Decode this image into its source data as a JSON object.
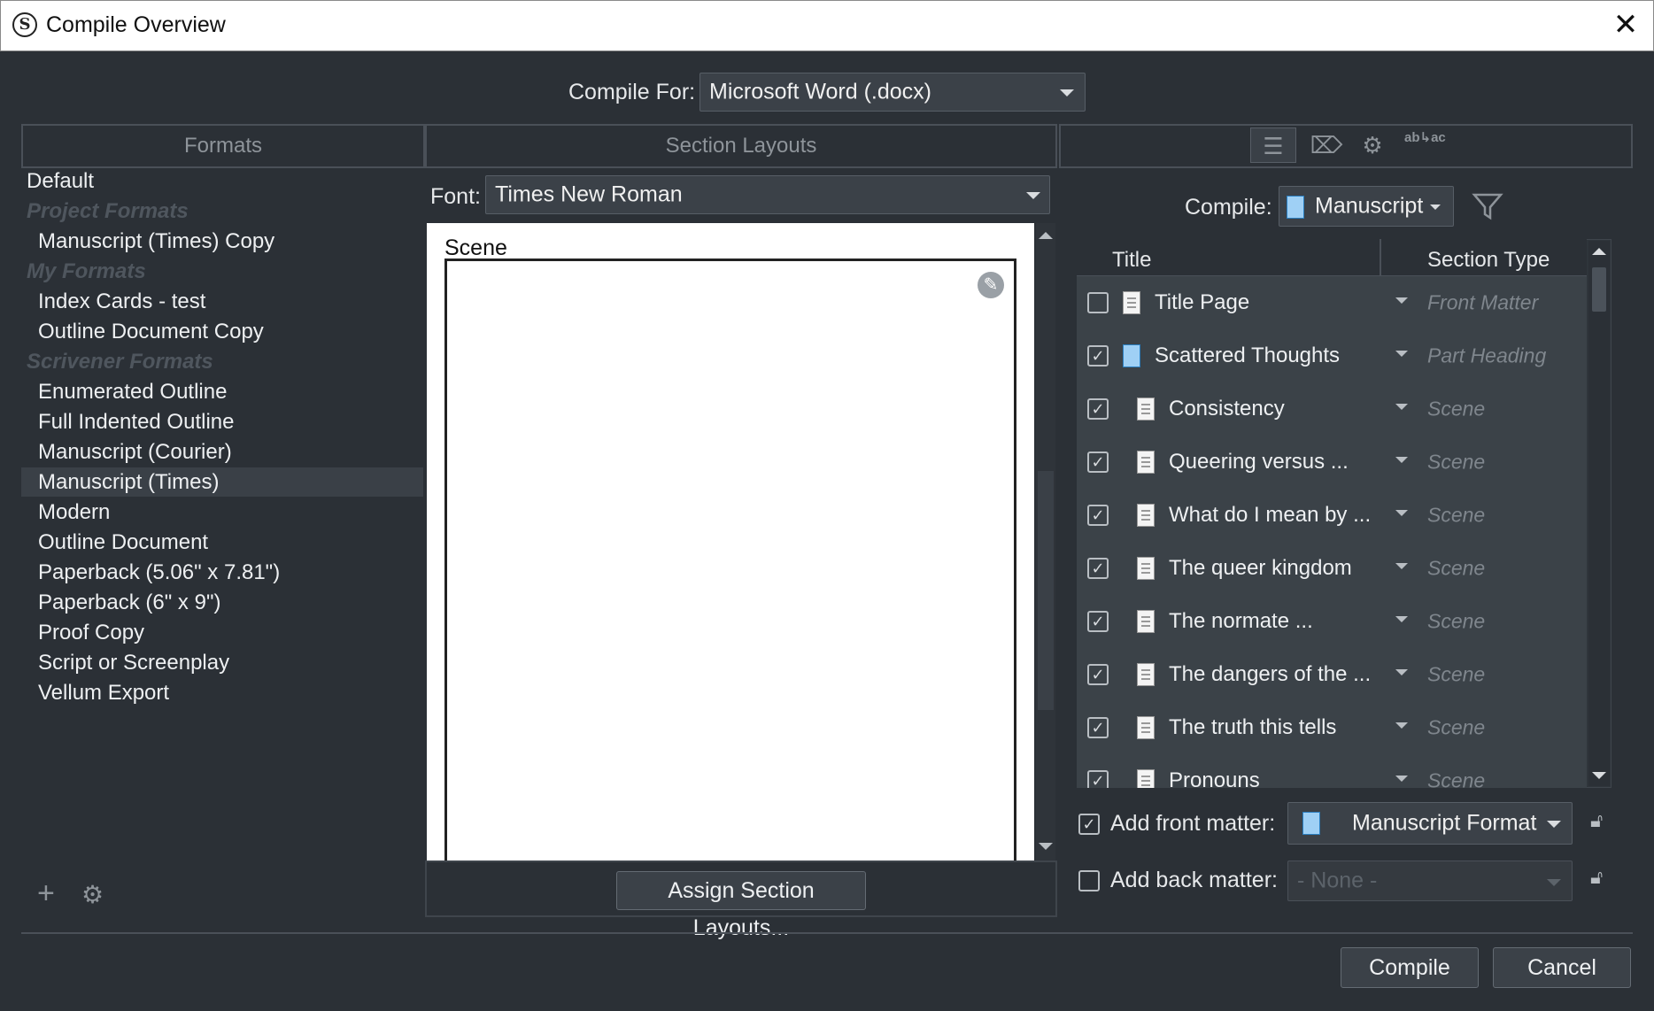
{
  "window": {
    "title": "Compile Overview",
    "app_icon_letter": "S",
    "close_glyph": "✕"
  },
  "compile_for": {
    "label": "Compile For:",
    "value": "Microsoft Word (.docx)"
  },
  "panels": {
    "formats_header": "Formats",
    "section_layouts_header": "Section Layouts"
  },
  "formats": {
    "items": [
      {
        "label": "Default",
        "kind": "item",
        "indent": false
      },
      {
        "label": "Project Formats",
        "kind": "group"
      },
      {
        "label": "Manuscript (Times) Copy",
        "kind": "item",
        "indent": true
      },
      {
        "label": "My Formats",
        "kind": "group"
      },
      {
        "label": "Index Cards - test",
        "kind": "item",
        "indent": true
      },
      {
        "label": "Outline Document Copy",
        "kind": "item",
        "indent": true
      },
      {
        "label": "Scrivener Formats",
        "kind": "group"
      },
      {
        "label": "Enumerated Outline",
        "kind": "item",
        "indent": true
      },
      {
        "label": "Full Indented Outline",
        "kind": "item",
        "indent": true
      },
      {
        "label": "Manuscript (Courier)",
        "kind": "item",
        "indent": true
      },
      {
        "label": "Manuscript (Times)",
        "kind": "item",
        "indent": true,
        "selected": true
      },
      {
        "label": "Modern",
        "kind": "item",
        "indent": true
      },
      {
        "label": "Outline Document",
        "kind": "item",
        "indent": true
      },
      {
        "label": "Paperback (5.06\" x 7.81\")",
        "kind": "item",
        "indent": true
      },
      {
        "label": "Paperback (6\" x 9\")",
        "kind": "item",
        "indent": true
      },
      {
        "label": "Proof Copy",
        "kind": "item",
        "indent": true
      },
      {
        "label": "Script or Screenplay",
        "kind": "item",
        "indent": true
      },
      {
        "label": "Vellum Export",
        "kind": "item",
        "indent": true
      }
    ],
    "add_glyph": "+",
    "gear_glyph": "⚙"
  },
  "section_layouts": {
    "font_label": "Font:",
    "font_value": "Times New Roman",
    "preview_title": "Scene",
    "assign_button": "Assign Section Layouts..."
  },
  "toolbar": {
    "icons": [
      "list-icon",
      "label-icon",
      "gear-icon",
      "replace-icon"
    ],
    "replace_text": "ab↳ac"
  },
  "contents": {
    "compile_label": "Compile:",
    "compile_value": "Manuscript",
    "columns": {
      "title": "Title",
      "section_type": "Section Type"
    },
    "rows": [
      {
        "title": "Title Page",
        "type": "Front Matter",
        "checked": false,
        "icon": "doc",
        "level": 0
      },
      {
        "title": "Scattered Thoughts",
        "type": "Part Heading",
        "checked": true,
        "icon": "folder",
        "level": 0
      },
      {
        "title": "Consistency",
        "type": "Scene",
        "checked": true,
        "icon": "doc",
        "level": 1
      },
      {
        "title": "Queering versus ...",
        "type": "Scene",
        "checked": true,
        "icon": "doc",
        "level": 1
      },
      {
        "title": "What do I mean by ...",
        "type": "Scene",
        "checked": true,
        "icon": "doc",
        "level": 1
      },
      {
        "title": "The queer kingdom",
        "type": "Scene",
        "checked": true,
        "icon": "doc",
        "level": 1
      },
      {
        "title": "The normate ...",
        "type": "Scene",
        "checked": true,
        "icon": "doc",
        "level": 1
      },
      {
        "title": "The dangers of the ...",
        "type": "Scene",
        "checked": true,
        "icon": "doc",
        "level": 1
      },
      {
        "title": "The truth this tells",
        "type": "Scene",
        "checked": true,
        "icon": "doc",
        "level": 1
      },
      {
        "title": "Pronouns",
        "type": "Scene",
        "checked": true,
        "icon": "doc",
        "level": 1
      }
    ],
    "front_matter": {
      "label": "Add front matter:",
      "checked": true,
      "value": "Manuscript Format"
    },
    "back_matter": {
      "label": "Add back matter:",
      "checked": false,
      "value": "- None -"
    }
  },
  "footer": {
    "compile_button": "Compile",
    "cancel_button": "Cancel"
  },
  "colors": {
    "background": "#2b3036",
    "panel_border": "#4a5058",
    "accent_blue": "#9fd0f5"
  }
}
